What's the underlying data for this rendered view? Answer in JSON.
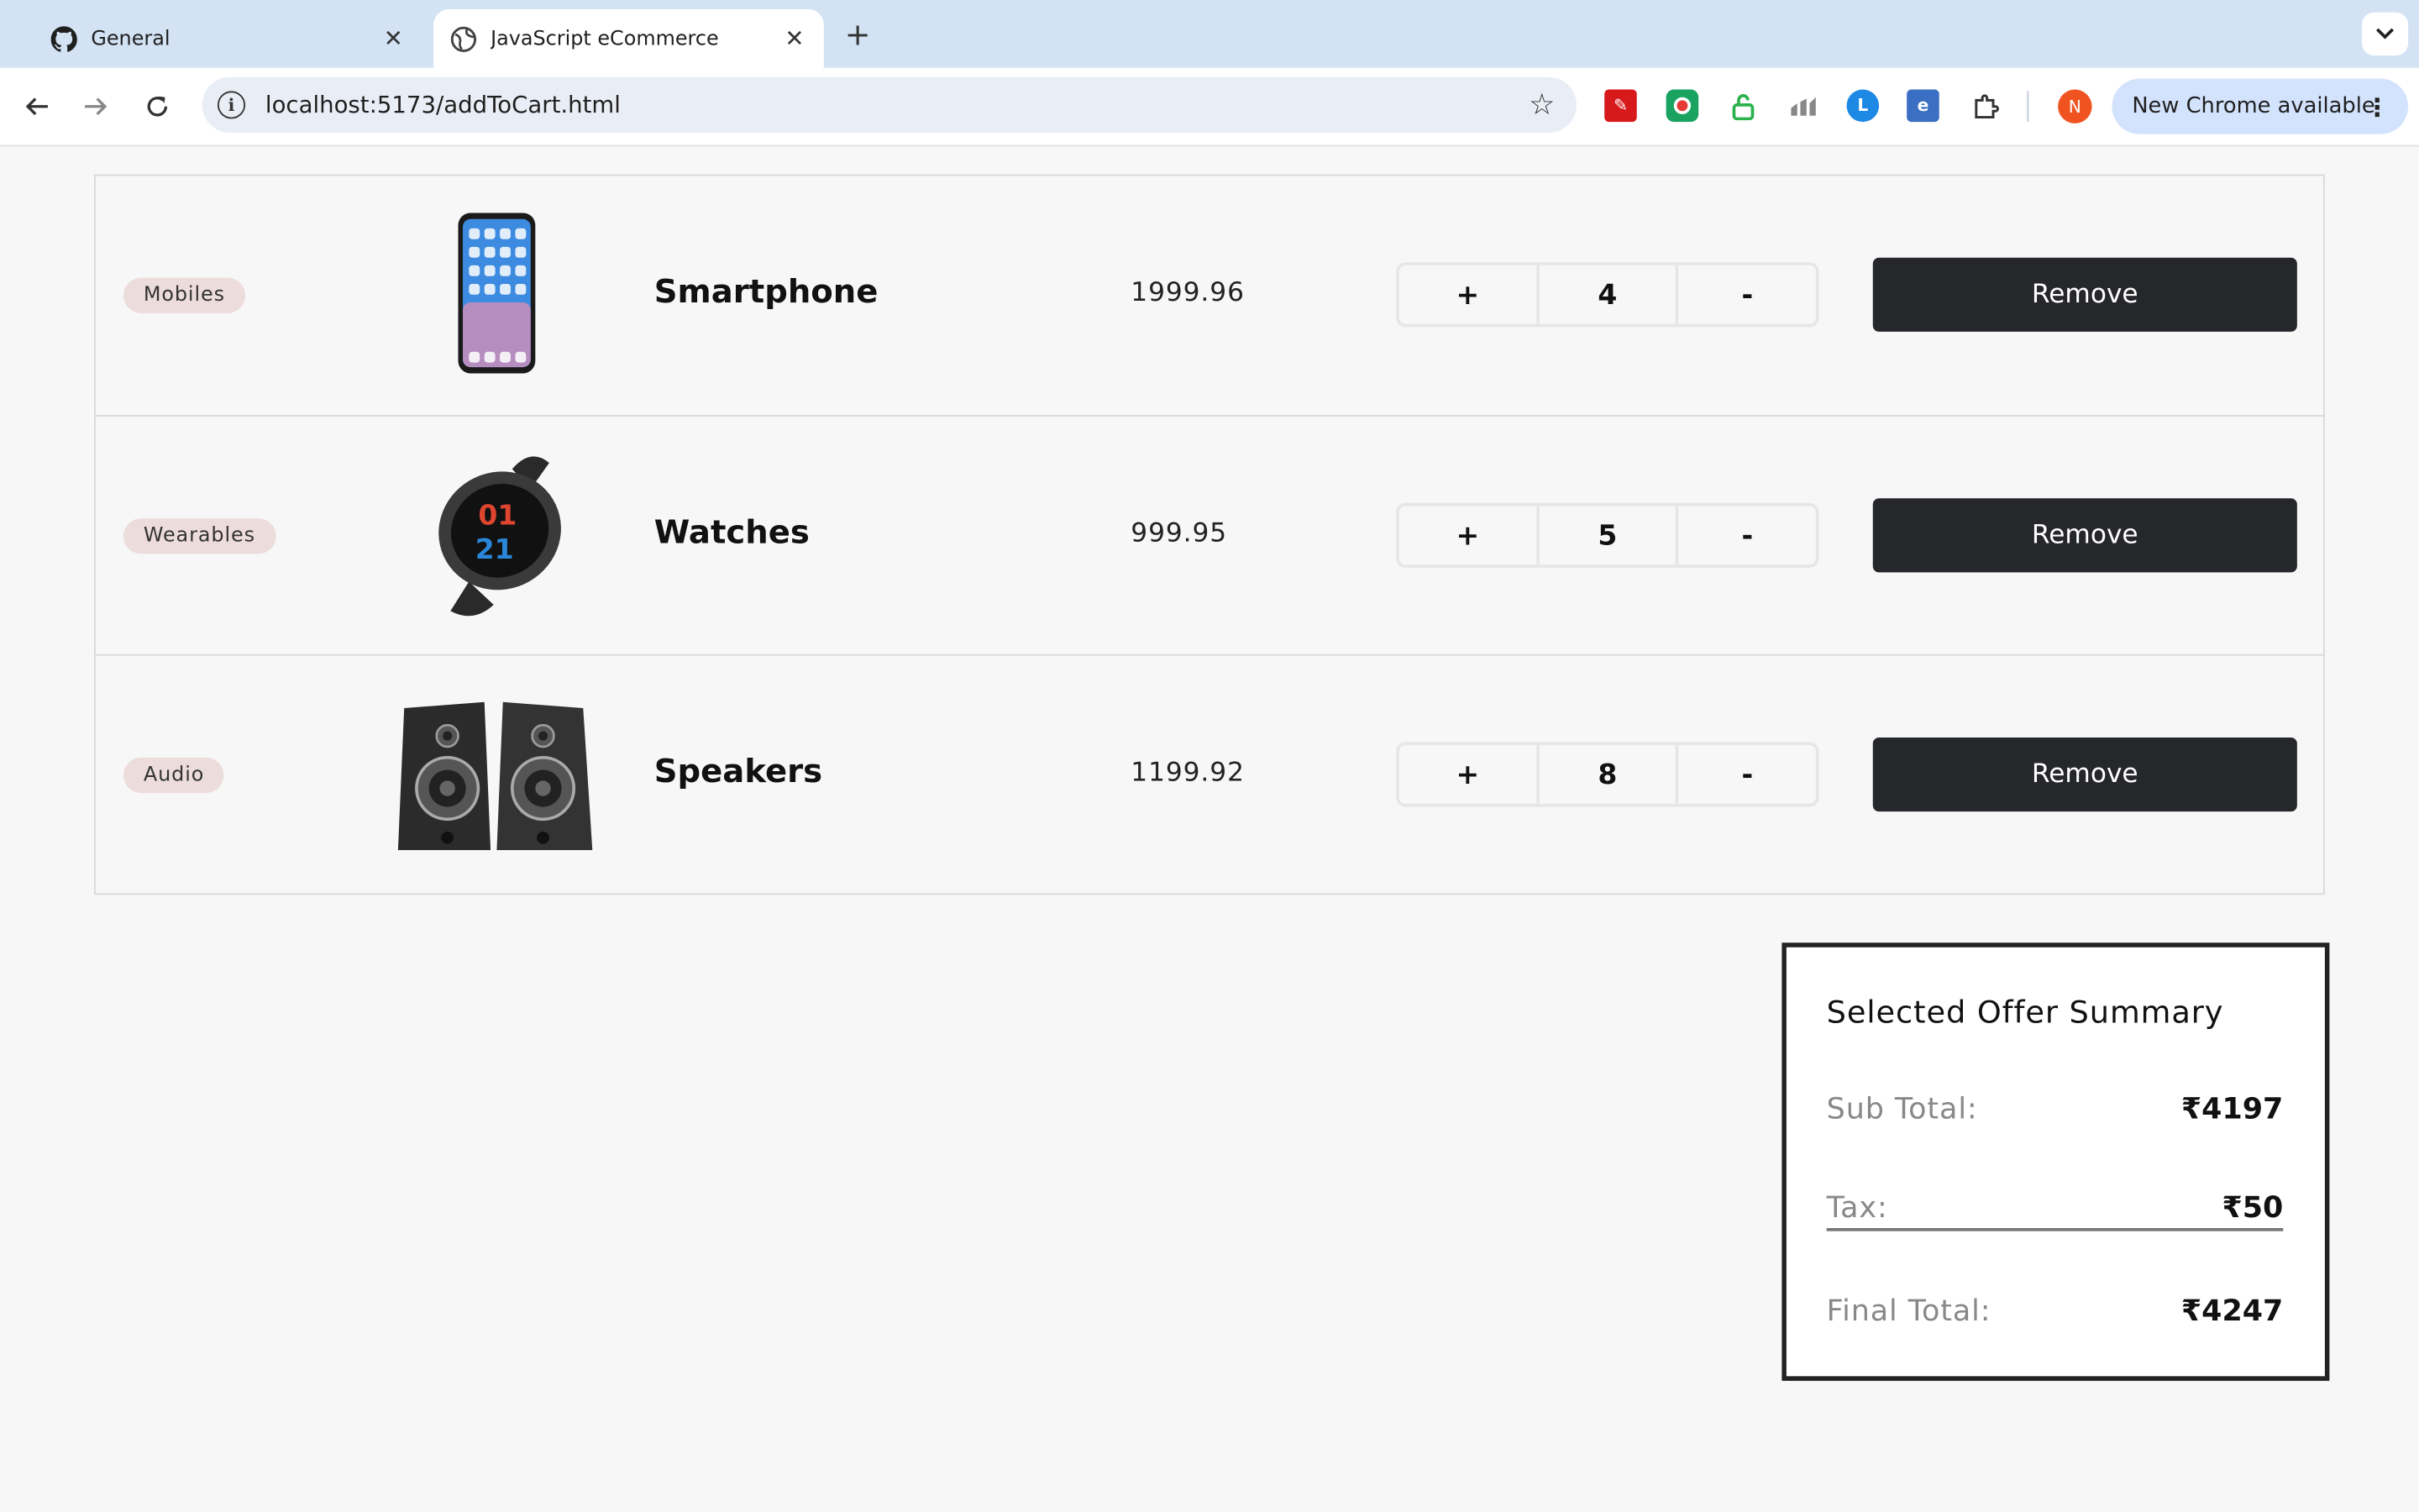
{
  "browser": {
    "tabs": [
      {
        "title": "General",
        "icon": "github-icon"
      },
      {
        "title": "JavaScript eCommerce",
        "icon": "globe-icon"
      }
    ],
    "url": "localhost:5173/addToCart.html",
    "chrome_update_label": "New Chrome available",
    "profile_initial": "N"
  },
  "cart": {
    "items": [
      {
        "category": "Mobiles",
        "name": "Smartphone",
        "price": "1999.96",
        "quantity": "4",
        "plus_label": "+",
        "minus_label": "-",
        "remove_label": "Remove",
        "image": "smartphone-image"
      },
      {
        "category": "Wearables",
        "name": "Watches",
        "price": "999.95",
        "quantity": "5",
        "plus_label": "+",
        "minus_label": "-",
        "remove_label": "Remove",
        "image": "smartwatch-image"
      },
      {
        "category": "Audio",
        "name": "Speakers",
        "price": "1199.92",
        "quantity": "8",
        "plus_label": "+",
        "minus_label": "-",
        "remove_label": "Remove",
        "image": "speakers-image"
      }
    ]
  },
  "summary": {
    "title": "Selected Offer Summary",
    "subtotal_label": "Sub Total:",
    "subtotal_value": "₹4197",
    "tax_label": "Tax:",
    "tax_value": "₹50",
    "final_label": "Final Total:",
    "final_value": "₹4247"
  }
}
